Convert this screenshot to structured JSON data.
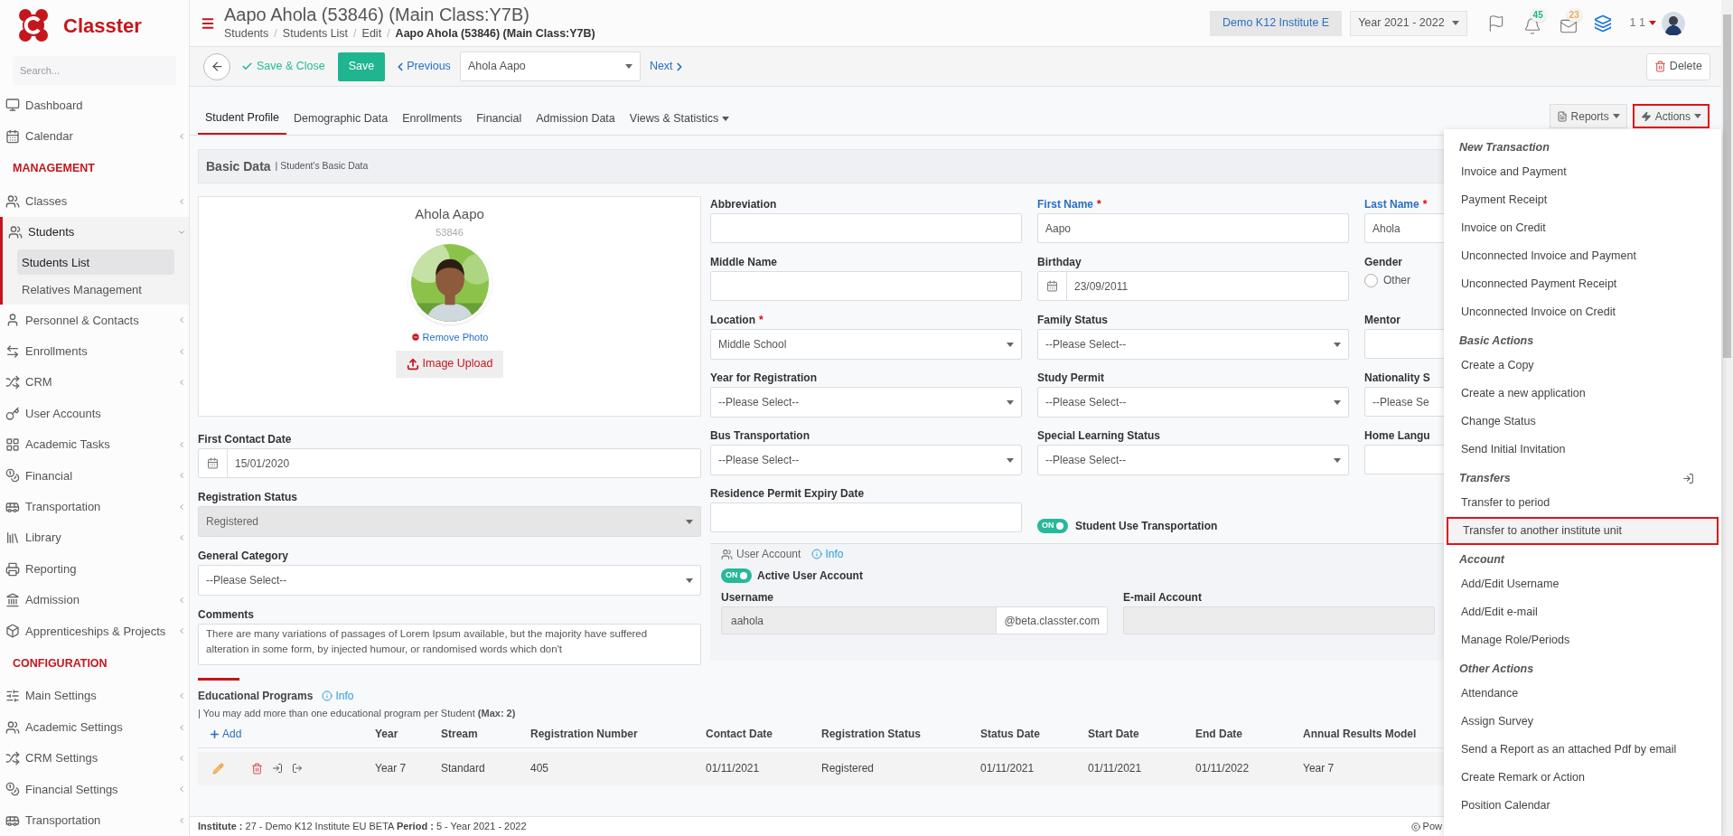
{
  "sidebar": {
    "logo_text": "Classter",
    "search_placeholder": "Search...",
    "items": [
      {
        "kind": "link",
        "label": "Dashboard",
        "submenu": false,
        "expanded": false
      },
      {
        "kind": "link",
        "label": "Calendar",
        "submenu": true,
        "expanded": false
      },
      {
        "kind": "heading",
        "label": "MANAGEMENT"
      },
      {
        "kind": "link",
        "label": "Classes",
        "submenu": true,
        "expanded": false
      },
      {
        "kind": "link",
        "label": "Students",
        "submenu": true,
        "expanded": true,
        "children": [
          {
            "label": "Students List",
            "selected": true
          },
          {
            "label": "Relatives Management",
            "selected": false
          }
        ]
      },
      {
        "kind": "link",
        "label": "Personnel & Contacts",
        "submenu": true,
        "expanded": false
      },
      {
        "kind": "link",
        "label": "Enrollments",
        "submenu": true,
        "expanded": false
      },
      {
        "kind": "link",
        "label": "CRM",
        "submenu": true,
        "expanded": false
      },
      {
        "kind": "link",
        "label": "User Accounts",
        "submenu": false,
        "expanded": false
      },
      {
        "kind": "link",
        "label": "Academic Tasks",
        "submenu": true,
        "expanded": false
      },
      {
        "kind": "link",
        "label": "Financial",
        "submenu": true,
        "expanded": false
      },
      {
        "kind": "link",
        "label": "Transportation",
        "submenu": true,
        "expanded": false
      },
      {
        "kind": "link",
        "label": "Library",
        "submenu": true,
        "expanded": false
      },
      {
        "kind": "link",
        "label": "Reporting",
        "submenu": false,
        "expanded": false
      },
      {
        "kind": "link",
        "label": "Admission",
        "submenu": true,
        "expanded": false
      },
      {
        "kind": "link",
        "label": "Apprenticeships & Projects",
        "submenu": true,
        "expanded": false
      },
      {
        "kind": "heading",
        "label": "CONFIGURATION"
      },
      {
        "kind": "link",
        "label": "Main Settings",
        "submenu": true,
        "expanded": false
      },
      {
        "kind": "link",
        "label": "Academic Settings",
        "submenu": true,
        "expanded": false
      },
      {
        "kind": "link",
        "label": "CRM Settings",
        "submenu": true,
        "expanded": false
      },
      {
        "kind": "link",
        "label": "Financial Settings",
        "submenu": true,
        "expanded": false
      },
      {
        "kind": "link",
        "label": "Transportation",
        "submenu": true,
        "expanded": false
      }
    ]
  },
  "header": {
    "title": "Aapo Ahola (53846) (Main Class:Y7B)",
    "separator": "/",
    "breadcrumb": [
      {
        "label": "Students",
        "current": false
      },
      {
        "label": "Students List",
        "current": false
      },
      {
        "label": "Edit",
        "current": false
      },
      {
        "label": "Aapo Ahola (53846) (Main Class:Y7B)",
        "current": true
      }
    ],
    "institute": "Demo K12 Institute E",
    "year": "Year 2021 - 2022",
    "notifications": [
      {
        "kind": "bell",
        "count": "45",
        "color": "#1fb58f"
      },
      {
        "kind": "mail",
        "count": "23",
        "color": "#f0ad4e"
      }
    ],
    "user": "1 1"
  },
  "toolbar": {
    "save_close": "Save & Close",
    "save": "Save",
    "previous": "Previous",
    "record": "Ahola Aapo",
    "next": "Next",
    "delete": "Delete"
  },
  "tabs": [
    {
      "label": "Student Profile",
      "selected": true,
      "kind": "tab"
    },
    {
      "label": "Demographic Data",
      "selected": false,
      "kind": "tab"
    },
    {
      "label": "Enrollments",
      "selected": false,
      "kind": "tab"
    },
    {
      "label": "Financial",
      "selected": false,
      "kind": "tab"
    },
    {
      "label": "Admission Data",
      "selected": false,
      "kind": "tab"
    },
    {
      "label": "Views & Statistics",
      "selected": false,
      "kind": "menu"
    }
  ],
  "tab_actions": [
    {
      "kind": "reports",
      "label": "Reports",
      "highlighted": false
    },
    {
      "kind": "actions",
      "label": "Actions",
      "highlighted": true
    }
  ],
  "section": {
    "title": "Basic Data",
    "subtitle": "| Student's Basic Data"
  },
  "profile": {
    "name": "Ahola Aapo",
    "id": "53846",
    "remove_photo": "Remove Photo",
    "upload": "Image Upload"
  },
  "left_fields": [
    {
      "kind": "date",
      "label": "First Contact Date",
      "value": "15/01/2020",
      "highlighted": false,
      "disabled": false
    },
    {
      "kind": "select",
      "label": "Registration Status",
      "value": "Registered",
      "highlighted": false,
      "disabled": true
    },
    {
      "kind": "select",
      "label": "General Category",
      "value": "--Please Select--",
      "highlighted": false,
      "disabled": false
    },
    {
      "kind": "textarea",
      "label": "Comments",
      "value": "There are many variations of passages of Lorem Ipsum available, but the majority have suffered alteration in some form, by injected humour, or randomised words which don't",
      "highlighted": false,
      "disabled": false
    }
  ],
  "fields": [
    [
      {
        "kind": "text",
        "label": "Abbreviation",
        "highlighted": false,
        "disabled": false
      },
      {
        "kind": "text",
        "label": "First Name",
        "required_mark": "*",
        "value": "Aapo",
        "highlighted": true,
        "disabled": false
      },
      {
        "kind": "text",
        "label": "Last Name",
        "required_mark": "*",
        "value": "Ahola",
        "highlighted": true,
        "disabled": false
      }
    ],
    [
      {
        "kind": "text",
        "label": "Middle Name",
        "highlighted": false,
        "disabled": false
      },
      {
        "kind": "date",
        "label": "Birthday",
        "value": "23/09/2011",
        "highlighted": false,
        "disabled": false
      },
      {
        "kind": "radio",
        "label": "Gender",
        "value": "Other",
        "checked": false,
        "highlighted": false,
        "disabled": false
      }
    ],
    [
      {
        "kind": "select",
        "label": "Location",
        "required_mark": "*",
        "value": "Middle School",
        "highlighted": false,
        "disabled": false
      },
      {
        "kind": "select",
        "label": "Family Status",
        "value": "--Please Select--",
        "highlighted": false,
        "disabled": false
      },
      {
        "kind": "text",
        "label": "Mentor",
        "highlighted": false,
        "disabled": false
      }
    ],
    [
      {
        "kind": "select",
        "label": "Year for Registration",
        "value": "--Please Select--",
        "highlighted": false,
        "disabled": false
      },
      {
        "kind": "select",
        "label": "Study Permit",
        "value": "--Please Select--",
        "highlighted": false,
        "disabled": false
      },
      {
        "kind": "text",
        "label": "Nationality S",
        "value": "--Please Se",
        "highlighted": false,
        "disabled": false
      }
    ],
    [
      {
        "kind": "select",
        "label": "Bus Transportation",
        "value": "--Please Select--",
        "highlighted": false,
        "disabled": false
      },
      {
        "kind": "select",
        "label": "Special Learning Status",
        "value": "--Please Select--",
        "highlighted": false,
        "disabled": false
      },
      {
        "kind": "text",
        "label": "Home Langu",
        "highlighted": false,
        "disabled": false
      }
    ],
    [
      {
        "kind": "text",
        "label": "Residence Permit Expiry Date",
        "highlighted": false,
        "disabled": false
      },
      {
        "kind": "toggle",
        "label": "Student Use Transportation",
        "on": true,
        "on_text": "ON"
      }
    ]
  ],
  "user_account": {
    "title": "User Account",
    "info": "Info",
    "toggle": {
      "label": "Active User Account",
      "on": true,
      "on_text": "ON"
    },
    "username_label": "Username",
    "username": "aahola",
    "domain": "@beta.classter.com",
    "email_label": "E-mail Account"
  },
  "educational_programs": {
    "title": "Educational Programs",
    "info": "Info",
    "note": "| You may add more than one educational program per Student **(Max: 2)**",
    "add": "Add",
    "columns": [
      "Year",
      "Stream",
      "Registration Number",
      "Contact Date",
      "Registration Status",
      "Status Date",
      "Start Date",
      "End Date",
      "Annual Results Model"
    ],
    "rows": [
      [
        "Year 7",
        "Standard",
        "405",
        "01/11/2021",
        "Registered",
        "01/11/2021",
        "01/11/2021",
        "01/11/2022",
        "Year 7"
      ]
    ]
  },
  "footer": {
    "text": "**Institute :** 27 - Demo K12 Institute EU BETA **Period :** 5 - Year 2021 - 2022",
    "powered": "Pow"
  },
  "actions_menu": {
    "groups": [
      {
        "title": "New Transaction",
        "has_icon": false,
        "items": [
          {
            "label": "Invoice and Payment",
            "selected": false
          },
          {
            "label": "Payment Receipt",
            "selected": false
          },
          {
            "label": "Invoice on Credit",
            "selected": false
          },
          {
            "label": "Unconnected Invoice and Payment",
            "selected": false
          },
          {
            "label": "Unconnected Payment Receipt",
            "selected": false
          },
          {
            "label": "Unconnected Invoice on Credit",
            "selected": false
          }
        ]
      },
      {
        "title": "Basic Actions",
        "has_icon": false,
        "items": [
          {
            "label": "Create a Copy",
            "selected": false
          },
          {
            "label": "Create a new application",
            "selected": false
          },
          {
            "label": "Change Status",
            "selected": false
          },
          {
            "label": "Send Initial Invitation",
            "selected": false
          }
        ]
      },
      {
        "title": "Transfers",
        "has_icon": true,
        "items": [
          {
            "label": "Transfer to period",
            "selected": false
          },
          {
            "label": "Transfer to another institute unit",
            "selected": true
          }
        ]
      },
      {
        "title": "Account",
        "has_icon": false,
        "items": [
          {
            "label": "Add/Edit Username",
            "selected": false
          },
          {
            "label": "Add/Edit e-mail",
            "selected": false
          },
          {
            "label": "Manage Role/Periods",
            "selected": false
          }
        ]
      },
      {
        "title": "Other Actions",
        "has_icon": false,
        "items": [
          {
            "label": "Attendance",
            "selected": false
          },
          {
            "label": "Assign Survey",
            "selected": false
          },
          {
            "label": "Send a Report as an attached Pdf by email",
            "selected": false
          },
          {
            "label": "Create Remark or Action",
            "selected": false
          },
          {
            "label": "Position Calendar",
            "selected": false
          }
        ]
      }
    ]
  }
}
